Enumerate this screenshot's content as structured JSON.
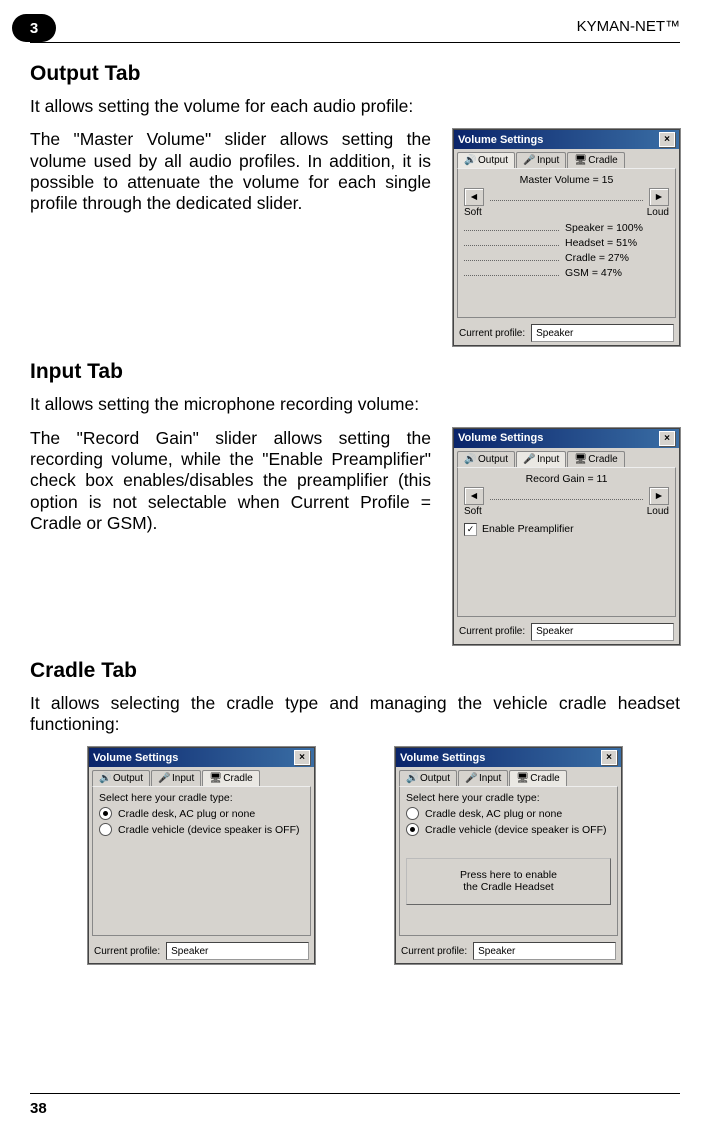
{
  "header": {
    "product": "KYMAN-NET™",
    "chapter": "3",
    "page": "38"
  },
  "section1": {
    "title": "Output Tab",
    "intro": "It allows setting the volume for each audio profile:",
    "para": "The \"Master Volume\" slider allows setting the volume used by all audio profiles. In addition, it is possible to attenuate the volume for each single profile through the dedicated slider."
  },
  "section2": {
    "title": "Input Tab",
    "intro": "It allows setting the microphone recording volume:",
    "para": "The \"Record Gain\" slider allows setting the recording volume, while the \"Enable Preamplifier\" check box enables/disables the preamplifier (this option is not selectable when Current Profile = Cradle or GSM)."
  },
  "section3": {
    "title": "Cradle Tab",
    "intro": "It allows selecting the cradle type and managing the vehicle cradle headset functioning:"
  },
  "vs": {
    "title": "Volume Settings",
    "close": "×",
    "tabs": {
      "output": "Output",
      "input": "Input",
      "cradle": "Cradle"
    },
    "output": {
      "master_label": "Master Volume = 15",
      "soft": "Soft",
      "loud": "Loud",
      "rows": [
        {
          "label": "Speaker = 100%"
        },
        {
          "label": "Headset = 51%"
        },
        {
          "label": "Cradle = 27%"
        },
        {
          "label": "GSM = 47%"
        }
      ]
    },
    "input": {
      "gain_label": "Record Gain = 11",
      "soft": "Soft",
      "loud": "Loud",
      "preamp": "Enable Preamplifier"
    },
    "cradle": {
      "prompt": "Select here your cradle type:",
      "opt1": "Cradle desk, AC plug or none",
      "opt2": "Cradle vehicle (device speaker is OFF)",
      "pressbtn": "Press here to enable\nthe Cradle Headset"
    },
    "curprof_label": "Current profile:",
    "curprof_val": "Speaker"
  }
}
